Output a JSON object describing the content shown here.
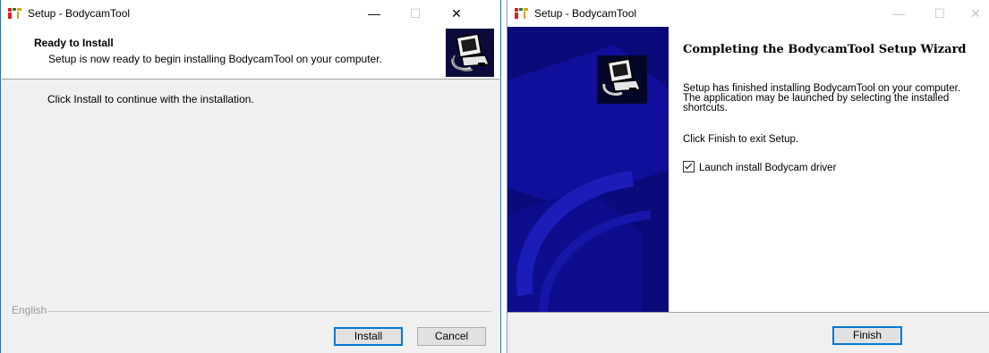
{
  "install_window": {
    "title": "Setup - BodycamTool",
    "header": {
      "title": "Ready to Install",
      "subtitle": "Setup is now ready to begin installing BodycamTool on your computer."
    },
    "body_text": "Click Install to continue with the installation.",
    "footer_label": "English",
    "buttons": {
      "install": "Install",
      "cancel": "Cancel"
    },
    "titlebar": {
      "minimize": "—",
      "maximize": "☐",
      "close": "✕"
    }
  },
  "finish_window": {
    "title": "Setup - BodycamTool",
    "heading": "Completing the BodycamTool Setup Wizard",
    "body_line1": "Setup has finished installing BodycamTool on your computer.",
    "body_line2": "The application may be launched by selecting the installed",
    "body_line3": "shortcuts.",
    "exit_text": "Click Finish to exit Setup.",
    "checkbox": {
      "label": "Launch install Bodycam driver",
      "checked": true
    },
    "buttons": {
      "finish": "Finish"
    },
    "titlebar": {
      "minimize": "—",
      "maximize": "☐",
      "close": "✕"
    }
  },
  "colors": {
    "side_panel": "#0a0a7a",
    "default_button_border": "#0078d7",
    "window_border": "#2b6fb6"
  },
  "icons": [
    "setup-app-icon",
    "computer-install-icon"
  ]
}
